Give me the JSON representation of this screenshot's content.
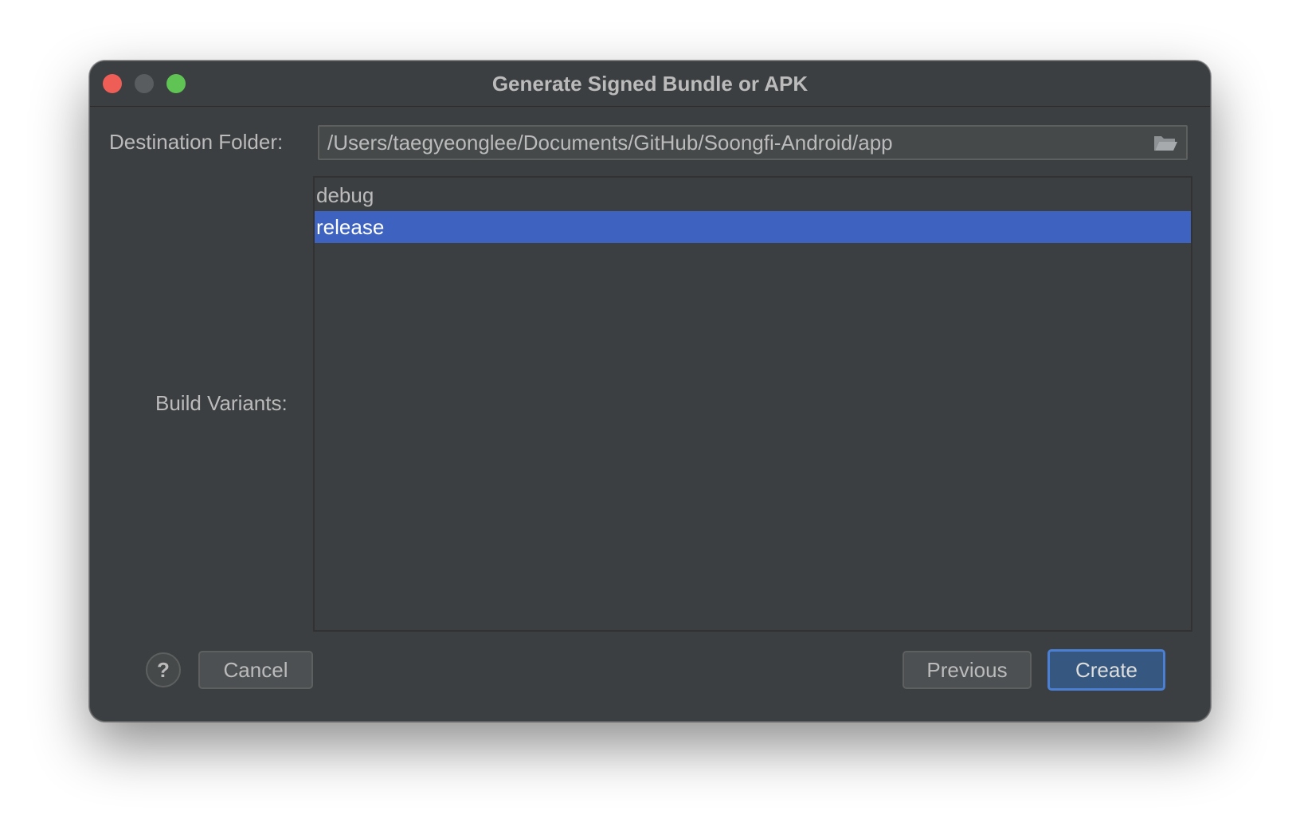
{
  "window": {
    "title": "Generate Signed Bundle or APK"
  },
  "form": {
    "destination_label": "Destination Folder:",
    "destination_value": "/Users/taegyeonglee/Documents/GitHub/Soongfi-Android/app",
    "destination_icon": "folder-open-icon",
    "variants_label": "Build Variants:",
    "variants": [
      {
        "label": "debug",
        "selected": false
      },
      {
        "label": "release",
        "selected": true
      }
    ]
  },
  "footer": {
    "help_label": "?",
    "cancel_label": "Cancel",
    "previous_label": "Previous",
    "create_label": "Create"
  },
  "colors": {
    "window_bg": "#3c3f41",
    "selection": "#3d62c0",
    "default_button_border": "#4a7fd4",
    "close": "#ee5e57",
    "maximize": "#5fc454"
  }
}
